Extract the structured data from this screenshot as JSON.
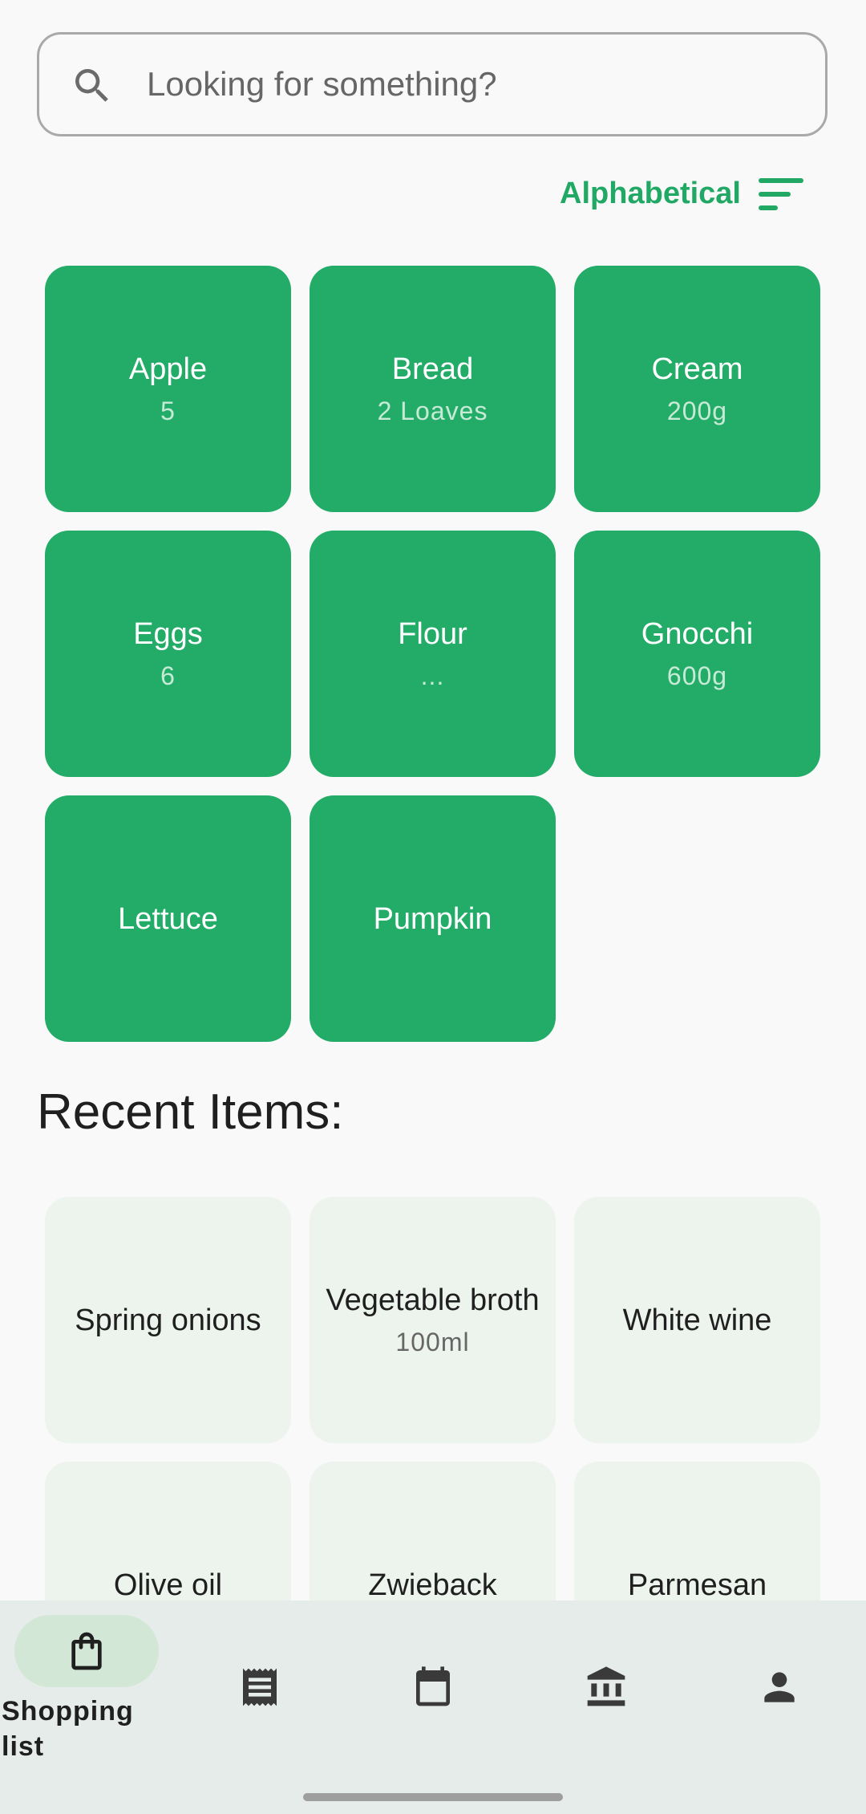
{
  "search": {
    "placeholder": "Looking for something?"
  },
  "sort": {
    "label": "Alphabetical"
  },
  "shopping_items": [
    {
      "name": "Apple",
      "quantity": "5"
    },
    {
      "name": "Bread",
      "quantity": "2 Loaves"
    },
    {
      "name": "Cream",
      "quantity": "200g"
    },
    {
      "name": "Eggs",
      "quantity": "6"
    },
    {
      "name": "Flour",
      "quantity": "..."
    },
    {
      "name": "Gnocchi",
      "quantity": "600g"
    },
    {
      "name": "Lettuce",
      "quantity": ""
    },
    {
      "name": "Pumpkin",
      "quantity": ""
    }
  ],
  "recent": {
    "title": "Recent Items:",
    "items": [
      {
        "name": "Spring onions",
        "quantity": ""
      },
      {
        "name": "Vegetable broth",
        "quantity": "100ml"
      },
      {
        "name": "White wine",
        "quantity": ""
      },
      {
        "name": "Olive oil",
        "quantity": ""
      },
      {
        "name": "Zwieback",
        "quantity": ""
      },
      {
        "name": "Parmesan",
        "quantity": ""
      }
    ]
  },
  "nav": {
    "items": [
      {
        "label": "Shopping list",
        "icon": "shopping-bag-icon",
        "active": true
      },
      {
        "label": "",
        "icon": "receipt-icon",
        "active": false
      },
      {
        "label": "",
        "icon": "calendar-icon",
        "active": false
      },
      {
        "label": "",
        "icon": "bank-icon",
        "active": false
      },
      {
        "label": "",
        "icon": "person-icon",
        "active": false
      }
    ]
  },
  "colors": {
    "accent": "#22ac68",
    "tile_light": "#edf4ee",
    "nav_bg": "#e5ecea",
    "nav_active_pill": "#d3e7d6"
  }
}
